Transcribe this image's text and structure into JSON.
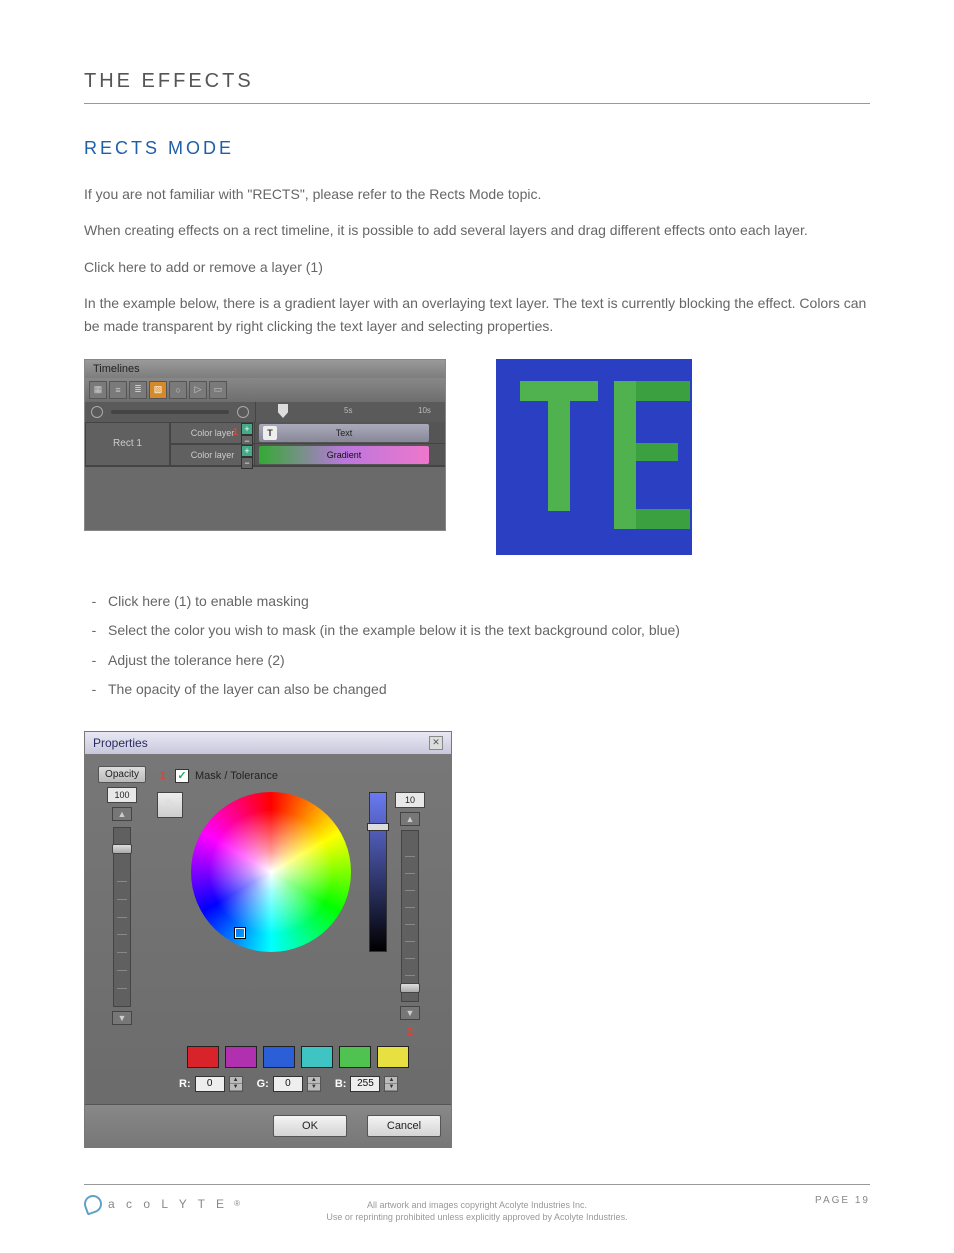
{
  "header": {
    "title": "THE EFFECTS"
  },
  "section": {
    "title": "RECTS MODE"
  },
  "paragraphs": {
    "p1": "If you are not familiar with \"RECTS\", please refer to the Rects Mode topic.",
    "p2": "When creating effects on a rect timeline, it is possible to add several layers and drag different effects onto each layer.",
    "p3": "Click here to add or remove a layer (1)",
    "p4": "In the example below, there is a gradient layer with an overlaying text layer. The text is currently blocking the effect. Colors can be made transparent by right clicking the text layer and selecting properties."
  },
  "timelines": {
    "title": "Timelines",
    "rect_label": "Rect 1",
    "layer_label": "Color layer",
    "callout1": "1",
    "ruler": {
      "t5": "5s",
      "t10": "10s"
    },
    "clips": {
      "text": "Text",
      "text_badge": "T",
      "gradient": "Gradient"
    }
  },
  "bullets": {
    "b1": "Click here (1) to enable masking",
    "b2": "Select the color you wish to mask (in the example below it is the text background color, blue)",
    "b3": "Adjust the tolerance here (2)",
    "b4": "The opacity of the layer can also be changed"
  },
  "properties": {
    "title": "Properties",
    "opacity_label": "Opacity",
    "opacity_value": "100",
    "mask_label": "Mask / Tolerance",
    "callout1": "1",
    "callout2": "2",
    "tolerance_value": "10",
    "rgb": {
      "r_label": "R:",
      "r": "0",
      "g_label": "G:",
      "g": "0",
      "b_label": "B:",
      "b": "255"
    },
    "ok": "OK",
    "cancel": "Cancel",
    "swatches": [
      "#d8232a",
      "#b030b0",
      "#2a5fd8",
      "#3fc4c4",
      "#4fc24f",
      "#e8e040"
    ]
  },
  "footer": {
    "brand": "a c o L Y T E",
    "copy1": "All artwork and images copyright Acolyte Industries Inc.",
    "copy2": "Use or reprinting prohibited unless explicitly approved by Acolyte Industries.",
    "page": "PAGE 19"
  }
}
